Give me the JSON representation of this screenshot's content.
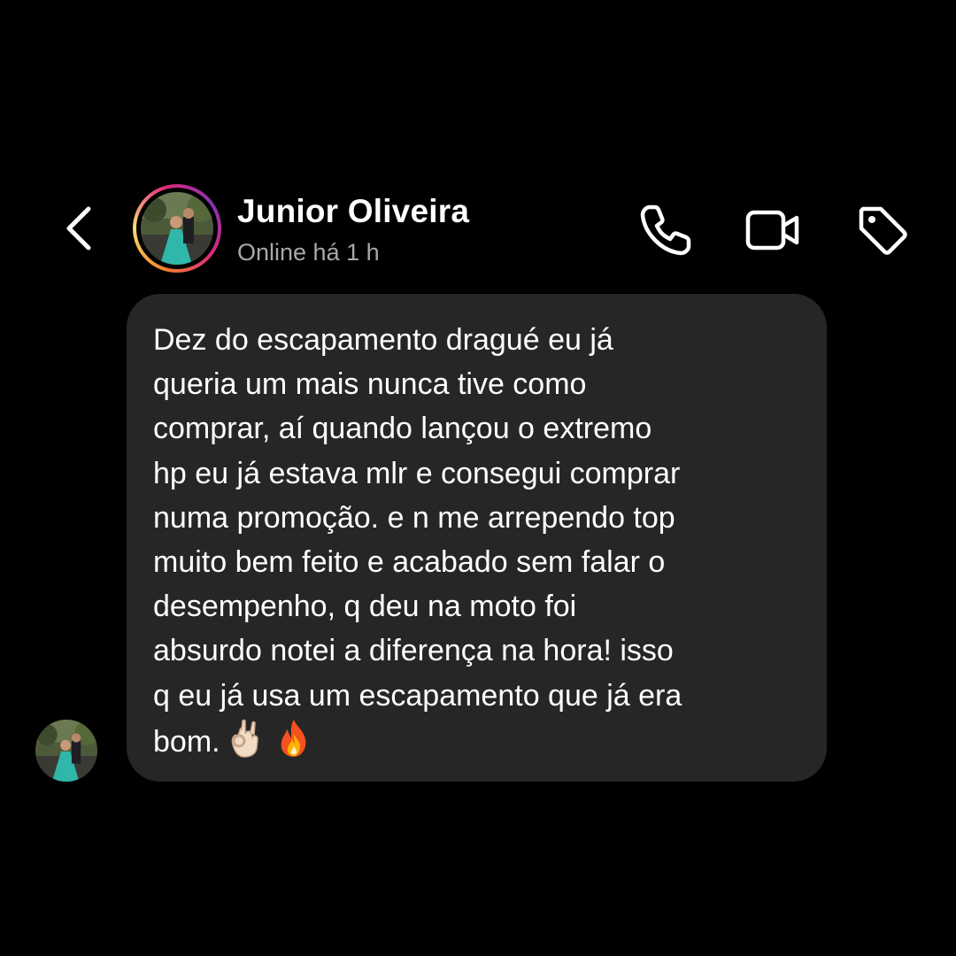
{
  "header": {
    "name": "Junior Oliveira",
    "status": "Online há 1 h",
    "back_icon": "chevron-left-icon",
    "call_icon": "phone-icon",
    "video_icon": "video-camera-icon",
    "tag_icon": "tag-icon"
  },
  "message": {
    "text": "Dez do escapamento dragué eu já\nqueria um mais nunca tive como\ncomprar, aí quando lançou o extremo\nhp  eu já estava mlr e consegui comprar\nnuma promoção. e n me arrependo top\nmuito bem feito e acabado sem falar o\ndesempenho, q deu na moto foi\nabsurdo notei a diferença na hora! isso\nq eu já usa um escapamento que já era\nbom.",
    "emojis": [
      "ok-hand-emoji",
      "fire-emoji"
    ]
  },
  "colors": {
    "background": "#000000",
    "bubble": "#262626",
    "text": "#ffffff",
    "status": "#a8a8a8"
  }
}
